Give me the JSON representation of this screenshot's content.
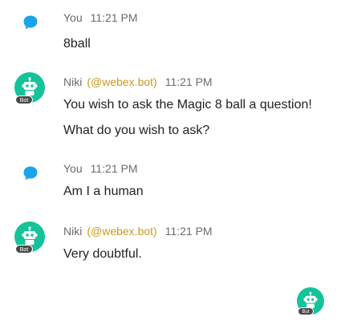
{
  "messages": [
    {
      "sender": "You",
      "handle": "",
      "time": "11:21 PM",
      "avatar": "chat-bubble-icon",
      "lines": [
        "8ball"
      ]
    },
    {
      "sender": "Niki",
      "handle": "(@webex.bot)",
      "time": "11:21 PM",
      "avatar": "bot-icon",
      "badge": "Bot",
      "lines": [
        "You wish to ask the Magic 8 ball a question!",
        "What do you wish to ask?"
      ]
    },
    {
      "sender": "You",
      "handle": "",
      "time": "11:21 PM",
      "avatar": "chat-bubble-icon",
      "lines": [
        "Am I a human"
      ]
    },
    {
      "sender": "Niki",
      "handle": "(@webex.bot)",
      "time": "11:21 PM",
      "avatar": "bot-icon",
      "badge": "Bot",
      "lines": [
        "Very doubtful."
      ]
    }
  ],
  "typing_indicator": {
    "avatar": "bot-icon",
    "badge": "Bot"
  },
  "colors": {
    "bot_avatar": "#14c39a",
    "you_icon": "#1aa3e8",
    "handle": "#c99a1e",
    "badge": "#4a4a4a"
  }
}
